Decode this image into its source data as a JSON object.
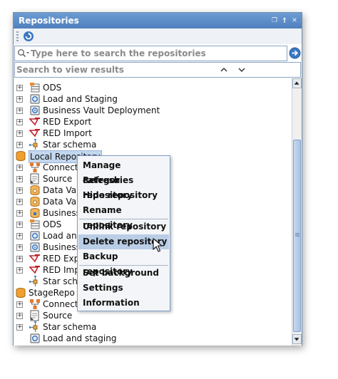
{
  "panel": {
    "title": "Repositories",
    "window_buttons": [
      "restore",
      "pin",
      "close"
    ]
  },
  "toolbar": {
    "refresh_icon": "refresh-icon"
  },
  "search": {
    "placeholder": "Type here to search the repositories",
    "value": "",
    "results_placeholder": "Search to view results"
  },
  "tree": {
    "rows": [
      {
        "label": "ODS",
        "icon": "ods-icon",
        "expandable": true
      },
      {
        "label": "Load and Staging",
        "icon": "load-icon",
        "expandable": true
      },
      {
        "label": "Business Vault Deployment",
        "icon": "deploy-icon",
        "expandable": true
      },
      {
        "label": "RED Export",
        "icon": "red-icon",
        "expandable": true
      },
      {
        "label": "RED Import",
        "icon": "red-icon",
        "expandable": true
      },
      {
        "label": "Star schema",
        "icon": "star-schema-icon",
        "expandable": true
      },
      {
        "label": "Local Repository",
        "icon": "repository-icon",
        "expandable": false,
        "selected": true
      },
      {
        "label": "Connecti",
        "icon": "connection-icon",
        "expandable": true
      },
      {
        "label": "Source",
        "icon": "source-icon",
        "expandable": true
      },
      {
        "label": "Data Vau",
        "icon": "datavault-icon",
        "expandable": true
      },
      {
        "label": "Data Vau",
        "icon": "datavault-icon",
        "expandable": true
      },
      {
        "label": "Business",
        "icon": "business-icon",
        "expandable": true
      },
      {
        "label": "ODS",
        "icon": "ods-icon",
        "expandable": true
      },
      {
        "label": "Load and",
        "icon": "load-icon",
        "expandable": true
      },
      {
        "label": "Business",
        "icon": "deploy-icon",
        "expandable": true
      },
      {
        "label": "RED Exp",
        "icon": "red-icon",
        "expandable": true
      },
      {
        "label": "RED Imp",
        "icon": "red-icon",
        "expandable": true
      },
      {
        "label": "Star schem",
        "icon": "star-schema-icon",
        "expandable": false
      },
      {
        "label": "StageRepo",
        "icon": "repository-icon",
        "expandable": false
      },
      {
        "label": "Connecti",
        "icon": "connection-icon",
        "expandable": true
      },
      {
        "label": "Source",
        "icon": "source-icon",
        "expandable": true
      },
      {
        "label": "Star schema",
        "icon": "star-schema-icon",
        "expandable": true
      },
      {
        "label": "Load and staging",
        "icon": "load-icon",
        "expandable": false
      }
    ]
  },
  "context_menu": {
    "items": [
      "Manage categories",
      "Refresh repository",
      "Hide repository",
      "Rename repository",
      "Unlink repository",
      "Delete repository",
      "Backup repository",
      "Set background",
      "Settings",
      "Information"
    ],
    "hovered": "Delete repository"
  },
  "colors": {
    "titlebar": "#5a8bc7",
    "selection": "#c3d7ee",
    "menu_hover": "#bacde6",
    "accent_blue": "#3a78c3"
  }
}
